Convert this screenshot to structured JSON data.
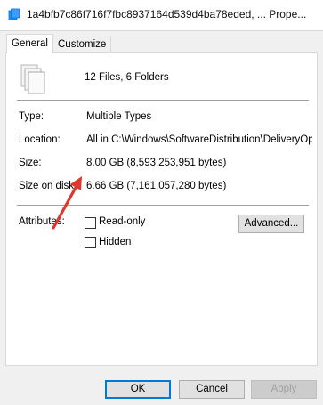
{
  "window": {
    "title": "1a4bfb7c86f716f7fbc8937164d539d4ba78eded, ... Prope..."
  },
  "tabs": [
    {
      "label": "General",
      "active": true
    },
    {
      "label": "Customize",
      "active": false
    }
  ],
  "summary": "12 Files, 6 Folders",
  "props": {
    "type_label": "Type:",
    "type_value": "Multiple Types",
    "location_label": "Location:",
    "location_value": "All in C:\\Windows\\SoftwareDistribution\\DeliveryOpt",
    "size_label": "Size:",
    "size_value": "8.00 GB (8,593,253,951 bytes)",
    "disk_label": "Size on disk:",
    "disk_value": "6.66 GB (7,161,057,280 bytes)"
  },
  "attributes": {
    "label": "Attributes:",
    "readonly_label": "Read-only",
    "hidden_label": "Hidden",
    "advanced_label": "Advanced..."
  },
  "buttons": {
    "ok": "OK",
    "cancel": "Cancel",
    "apply": "Apply"
  },
  "colors": {
    "annotation_arrow": "#e0362f",
    "default_button_border": "#0078d7"
  }
}
